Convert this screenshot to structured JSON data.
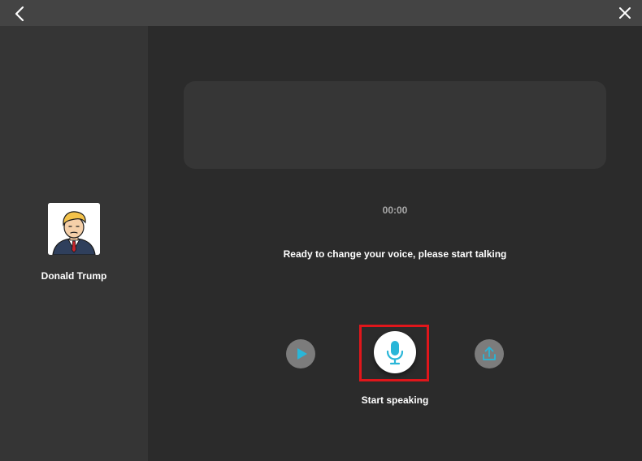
{
  "titlebar": {
    "back_icon": "chevron-left-icon",
    "close_icon": "close-icon"
  },
  "sidebar": {
    "character": {
      "name": "Donald Trump",
      "avatar_icon": "cartoon-portrait-avatar"
    }
  },
  "main": {
    "timer": "00:00",
    "status": "Ready to change your voice, please start talking"
  },
  "controls": {
    "play_icon": "play-icon",
    "mic_icon": "microphone-icon",
    "upload_icon": "upload-icon",
    "mic_label": "Start speaking"
  },
  "colors": {
    "accent": "#29b6d8",
    "highlight": "#e0161b",
    "titlebar": "#444444",
    "sidebar": "#353535",
    "background": "#2b2b2b"
  }
}
